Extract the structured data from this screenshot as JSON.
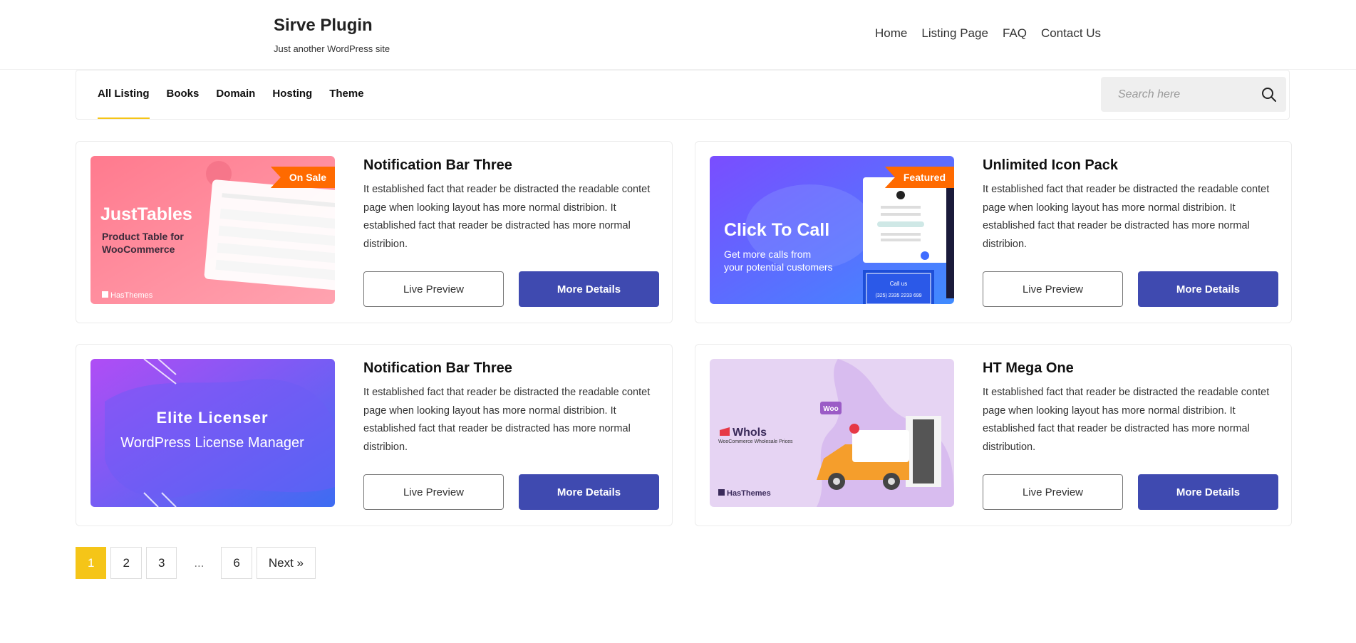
{
  "site": {
    "title": "Sirve Plugin",
    "tagline": "Just another WordPress site"
  },
  "nav": {
    "items": [
      "Home",
      "Listing Page",
      "FAQ",
      "Contact Us"
    ]
  },
  "filters": {
    "tabs": [
      "All Listing",
      "Books",
      "Domain",
      "Hosting",
      "Theme"
    ],
    "active": "All Listing"
  },
  "search": {
    "placeholder": "Search here"
  },
  "cards": [
    {
      "title": "Notification Bar Three",
      "description": "It established fact that reader be distracted the readable contet page when looking layout has more normal distribion. It established fact that reader be distracted has more normal distribion.",
      "badge": "On Sale",
      "live_preview": "Live Preview",
      "more_details": "More Details",
      "thumb": {
        "heading": "JustTables",
        "sub1": "Product Table for",
        "sub2": "WooCommerce",
        "brand": "HasThemes"
      }
    },
    {
      "title": "Unlimited Icon Pack",
      "description": "It established fact that reader be distracted the readable contet page when looking layout has more normal distribion. It established fact that reader be distracted has more normal distribion.",
      "badge": "Featured",
      "live_preview": "Live Preview",
      "more_details": "More Details",
      "thumb": {
        "heading": "Click To Call",
        "sub1": "Get more calls from",
        "sub2": "your potential customers",
        "callout": "Call us",
        "phone": "(325) 2335 2233 699"
      }
    },
    {
      "title": "Notification Bar Three",
      "description": "It established fact that reader be distracted the readable contet page when looking layout has more normal distribion. It established fact that reader be distracted has more normal distribion.",
      "badge": "",
      "live_preview": "Live Preview",
      "more_details": "More Details",
      "thumb": {
        "heading": "Elite Licenser",
        "sub1": "WordPress License Manager"
      }
    },
    {
      "title": "HT Mega One",
      "description": "It established fact that reader be distracted the readable contet page when looking layout has more normal distribion. It established fact that reader be distracted has more normal distribution.",
      "badge": "",
      "live_preview": "Live Preview",
      "more_details": "More Details",
      "thumb": {
        "heading": "Whols",
        "sub1": "WooCommerce Wholesale Prices",
        "brand": "HasThemes",
        "woo": "Woo"
      }
    }
  ],
  "pagination": {
    "pages": [
      "1",
      "2",
      "3",
      "...",
      "6"
    ],
    "active": "1",
    "next": "Next »"
  },
  "colors": {
    "accent": "#f5c518",
    "primary_button": "#3f4ab0",
    "ribbon": "#ff6a00"
  }
}
